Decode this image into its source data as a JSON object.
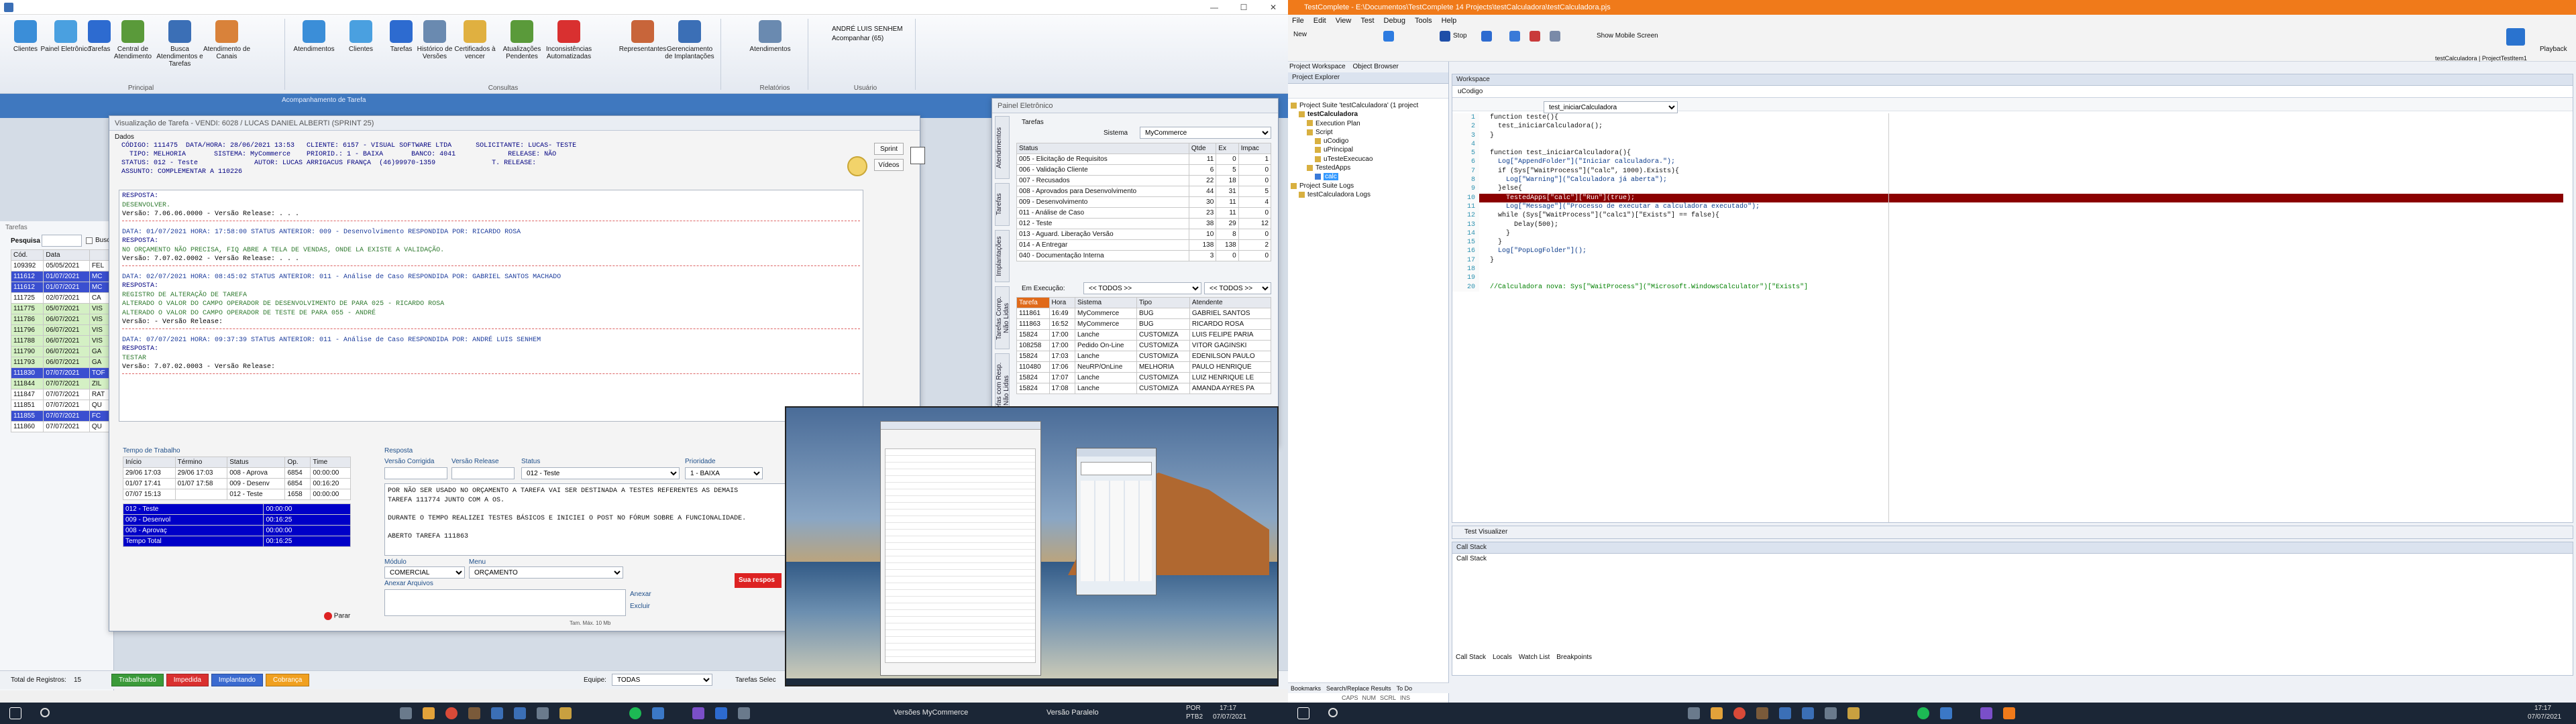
{
  "left": {
    "titlebar": {
      "controls": [
        "—",
        "☐",
        "✕"
      ]
    },
    "ribbon": {
      "buttons": [
        "Clientes",
        "Painel Eletrônico",
        "Tarefas",
        "Central de Atendimento",
        "Busca Atendimentos e Tarefas",
        "Atendimento de Canais",
        "Atendimentos",
        "Clientes",
        "Tarefas",
        "Histórico de Versões",
        "Certificados à vencer",
        "Atualizações Pendentes",
        "Inconsistências Automatizadas",
        "Representantes",
        "Gerenciamento de Implantações",
        "Atendimentos"
      ],
      "groups": [
        "Principal",
        "Consultas",
        "Relatórios",
        "Usuário"
      ],
      "user_name": "ANDRÉ LUIS SENHEM",
      "user_sub": "Acompanhar (65)"
    },
    "main_window_title": "Acompanhamento de Tarefa",
    "background_list": {
      "title": "Tarefas",
      "search_label": "Pesquisa",
      "search_check": "Busc",
      "headers": [
        "Cód.",
        "Data"
      ],
      "rows": [
        [
          "109392",
          "05/05/2021",
          "FEL"
        ],
        [
          "111612",
          "01/07/2021",
          "MC"
        ],
        [
          "111612",
          "01/07/2021",
          "MC"
        ],
        [
          "111725",
          "02/07/2021",
          "CA"
        ],
        [
          "111775",
          "05/07/2021",
          "VIS"
        ],
        [
          "111786",
          "06/07/2021",
          "VIS"
        ],
        [
          "111796",
          "06/07/2021",
          "VIS"
        ],
        [
          "111788",
          "06/07/2021",
          "VIS"
        ],
        [
          "111790",
          "06/07/2021",
          "GA"
        ],
        [
          "111793",
          "06/07/2021",
          "GA"
        ],
        [
          "111830",
          "07/07/2021",
          "TOF"
        ],
        [
          "111844",
          "07/07/2021",
          "ZIL"
        ],
        [
          "111847",
          "07/07/2021",
          "RAT"
        ],
        [
          "111851",
          "07/07/2021",
          "QU"
        ],
        [
          "111855",
          "07/07/2021",
          "FC"
        ],
        [
          "111860",
          "07/07/2021",
          "QU"
        ]
      ],
      "total_label": "Total de Registros:",
      "total_value": "15",
      "legend": [
        "Trabalhando",
        "Impedida",
        "Implantando",
        "Cobrança"
      ],
      "equipe_label": "Equipe:",
      "equipe_value": "TODAS",
      "tarefas_label": "Tarefas Selec"
    },
    "task_dialog": {
      "title": "Visualização de Tarefa - VENDI: 6028 / LUCAS DANIEL ALBERTI (SPRINT 25)",
      "dados_label": "Dados",
      "header_lines": [
        "CÓDIGO: 111475  DATA/HORA: 28/06/2021 13:53   CLIENTE: 6157 - VISUAL SOFTWARE LTDA      SOLICITANTE: LUCAS- TESTE",
        "  TIPO: MELHORIA       SISTEMA: MyCommerce    PRIORID.: 1 - BAIXA       BANCO: 4041             RELEASE: NÃO",
        "STATUS: 012 - Teste              AUTOR: LUCAS ARRIGACUS FRANÇA  (46)99970-1359              T. RELEASE:"
      ],
      "assunto": "ASSUNTO: COMPLEMENTAR A 110226",
      "side_buttons": [
        "Sprint",
        "Vídeos"
      ],
      "history": [
        {
          "line": "RESPOSTA:",
          "color": "navy"
        },
        {
          "line": "DESENVOLVER.",
          "color": "green"
        },
        {
          "line": "Versão: 7.06.06.0000  - Versão Release: . . .",
          "color": "mixed"
        },
        {
          "line": "DATA: 01/07/2021 HORA: 17:58:00   STATUS ANTERIOR: 009 - Desenvolvimento   RESPONDIDA POR: RICARDO ROSA",
          "color": "blue"
        },
        {
          "line": "RESPOSTA:",
          "color": "navy"
        },
        {
          "line": "NO ORÇAMENTO NÃO PRECISA, FIQ ABRE A TELA DE VENDAS, ONDE LA EXISTE A VALIDAÇÃO.",
          "color": "green"
        },
        {
          "line": "Versão: 7.07.02.0002  - Versão Release: . . .",
          "color": "mixed"
        },
        {
          "line": "DATA: 02/07/2021 HORA: 08:45:02   STATUS ANTERIOR: 011 - Análise de Caso  RESPONDIDA POR: GABRIEL SANTOS MACHADO",
          "color": "blue"
        },
        {
          "line": "RESPOSTA:",
          "color": "navy"
        },
        {
          "line": "REGISTRO DE ALTERAÇÃO DE TAREFA",
          "color": "green"
        },
        {
          "line": "ALTERADO O VALOR DO CAMPO OPERADOR DE DESENVOLVIMENTO DE  PARA 025 - RICARDO ROSA",
          "color": "green"
        },
        {
          "line": "ALTERADO O VALOR DO CAMPO OPERADOR DE TESTE DE  PARA 055 - ANDRÉ",
          "color": "green"
        },
        {
          "line": "Versão: -  Versão Release:",
          "color": "mixed"
        },
        {
          "line": "DATA: 07/07/2021 HORA: 09:37:39   STATUS ANTERIOR: 011 - Análise de Caso  RESPONDIDA POR: ANDRÉ LUIS SENHEM",
          "color": "blue"
        },
        {
          "line": "RESPOSTA:",
          "color": "navy"
        },
        {
          "line": "TESTAR",
          "color": "green"
        },
        {
          "line": "Versão: 7.07.02.0003  - Versão Release:",
          "color": "mixed"
        }
      ],
      "tempo": {
        "title": "Tempo de Trabalho",
        "headers": [
          "Início",
          "Término",
          "Status",
          "Op.",
          "Time"
        ],
        "rows": [
          [
            "29/06 17:03",
            "29/06 17:03",
            "008 - Aprova",
            "6854",
            "00:00:00"
          ],
          [
            "01/07 17:41",
            "01/07 17:58",
            "009 - Desenv",
            "6854",
            "00:16:20"
          ],
          [
            "07/07 15:13",
            "",
            "012 - Teste",
            "1658",
            "00:00:00"
          ]
        ],
        "summary": [
          [
            "012 - Teste",
            "00:00:00"
          ],
          [
            "009 - Desenvol",
            "00:16:25"
          ],
          [
            "008 - Aprovaç",
            "00:00:00"
          ],
          [
            "Tempo Total",
            "00:16:25"
          ]
        ],
        "stop_button": "Parar"
      },
      "resposta": {
        "label": "Resposta",
        "versao_corrigida": "Versão Corrigida",
        "versao_release": "Versão Release",
        "status_label": "Status",
        "status_value": "012 - Teste",
        "prioridade_label": "Prioridade",
        "prioridade_value": "1 - BAIXA",
        "text_lines": [
          "POR NÃO SER USADO NO ORÇAMENTO A TAREFA VAI SER DESTINADA A TESTES REFERENTES AS DEMAIS",
          "TAREFA 111774 JUNTO COM A OS.",
          "",
          "DURANTE O TEMPO REALIZEI TESTES BÁSICOS E INICIEI O POST NO FÓRUM SOBRE A FUNCIONALIDADE.",
          "",
          "ABERTO TAREFA 111863"
        ],
        "modulo_label": "Módulo",
        "modulo_value": "COMERCIAL",
        "menu_label": "Menu",
        "menu_value": "ORÇAMENTO",
        "anexar_label": "Anexar Arquivos",
        "anexar_btn": "Anexar",
        "excluir_btn": "Excluir",
        "tam_max": "Tam. Máx. 10 Mb",
        "sua_resposta": "Sua respos"
      }
    },
    "painel": {
      "title": "Painel Eletrônico",
      "tab_tarefas": "Tarefas",
      "sistema_label": "Sistema",
      "sistema_value": "MyCommerce",
      "vtabs": [
        "Atendimentos",
        "Tarefas",
        "Implantações",
        "Tarefas Comp. Não Lidas",
        "Tarefas com Resp. Não Lidas"
      ],
      "status_headers": [
        "Status",
        "Qtde",
        "Ex",
        "Impac"
      ],
      "status_rows": [
        [
          "005 - Elicitação de Requisitos",
          "11",
          "0",
          "1"
        ],
        [
          "006 - Validação Cliente",
          "6",
          "5",
          "0"
        ],
        [
          "007 - Recusados",
          "22",
          "18",
          "0"
        ],
        [
          "008 - Aprovados para Desenvolvimento",
          "44",
          "31",
          "5"
        ],
        [
          "009 - Desenvolvimento",
          "30",
          "11",
          "4"
        ],
        [
          "011 - Análise de Caso",
          "23",
          "11",
          "0"
        ],
        [
          "012 - Teste",
          "38",
          "29",
          "12"
        ],
        [
          "013 - Aguard. Liberação Versão",
          "10",
          "8",
          "0"
        ],
        [
          "014 - A Entregar",
          "138",
          "138",
          "2"
        ],
        [
          "040 - Documentação Interna",
          "3",
          "0",
          "0"
        ]
      ],
      "em_execucao": "Em Execução:",
      "todos1": "<< TODOS >>",
      "todos2": "<< TODOS >>",
      "exec_headers": [
        "Tarefa",
        "Hora",
        "Sistema",
        "Tipo",
        "Atendente"
      ],
      "exec_rows": [
        [
          "111861",
          "16:49",
          "MyCommerce",
          "BUG",
          "GABRIEL SANTOS"
        ],
        [
          "111863",
          "16:52",
          "MyCommerce",
          "BUG",
          "RICARDO ROSA"
        ],
        [
          "15824",
          "17:00",
          "Lanche",
          "CUSTOMIZA",
          "LUIS FELIPE PARIA"
        ],
        [
          "108258",
          "17:00",
          "Pedido On-Line",
          "CUSTOMIZA",
          "VITOR GAGINSKI"
        ],
        [
          "15824",
          "17:03",
          "Lanche",
          "CUSTOMIZA",
          "EDENILSON PAULO"
        ],
        [
          "110480",
          "17:06",
          "NeuRP/OnLine",
          "MELHORIA",
          "PAULO HENRIQUE"
        ],
        [
          "15824",
          "17:07",
          "Lanche",
          "CUSTOMIZA",
          "LUIZ HENRIQUE LE"
        ],
        [
          "15824",
          "17:08",
          "Lanche",
          "CUSTOMIZA",
          "AMANDA AYRES PA"
        ]
      ]
    }
  },
  "right": {
    "title": "TestComplete - E:\\Documentos\\TestComplete 14 Projects\\testCalculadora\\testCalculadora.pjs",
    "menu": [
      "File",
      "Edit",
      "View",
      "Test",
      "Debug",
      "Tools",
      "Help"
    ],
    "toolbar": {
      "new": "New",
      "stop": "Stop",
      "mobile": "Show Mobile Screen"
    },
    "playback": "Playback",
    "playback_sub": "testCalculadora | ProjectTestItem1",
    "tabs_left": [
      "Project Workspace",
      "Object Browser"
    ],
    "explorer_title": "Project Explorer",
    "tree": [
      "Project Suite 'testCalculadora' (1 project",
      "testCalculadora",
      "Execution Plan",
      "Script",
      "uCodigo",
      "uPrincipal",
      "uTesteExecucao",
      "TestedApps",
      "calc",
      "Project Suite Logs",
      "testCalculadora Logs"
    ],
    "workspace_title": "Workspace",
    "file_tab": "uCodigo",
    "func_select": "test_iniciarCalculadora",
    "code_lines": [
      "function teste(){",
      "  test_iniciarCalculadora();",
      "}",
      "",
      "function test_iniciarCalculadora(){",
      "  Log[\"AppendFolder\"](\"Iniciar calculadora.\");",
      "  if (Sys[\"WaitProcess\"](\"calc\", 1000).Exists){",
      "    Log[\"Warning\"](\"Calculadora já aberta\");",
      "  }else{",
      "    TestedApps[\"calc\"][\"Run\"](true);",
      "    Log[\"Message\"](\"Processo de executar a calculadora executado\");",
      "  while (Sys[\"WaitProcess\"](\"calc1\")[\"Exists\"] == false){",
      "      Delay(500);",
      "    }",
      "  }",
      "  Log[\"PopLogFolder\"]();",
      "}",
      "",
      "",
      "//Calculadora nova: Sys[\"WaitProcess\"](\"Microsoft.WindowsCalculator\")[\"Exists\"]"
    ],
    "line_numbers": [
      "1",
      "2",
      "3",
      "4",
      "5",
      "6",
      "7",
      "8",
      "9",
      "10",
      "11",
      "12",
      "13",
      "14",
      "15",
      "16",
      "17",
      "18",
      "19",
      "20"
    ],
    "test_visualizer": "Test Visualizer",
    "call_stack_title": "Call Stack",
    "call_stack_content": "Call Stack",
    "bottom_tabs": [
      "Call Stack",
      "Locals",
      "Watch List",
      "Breakpoints"
    ],
    "left_bottom_tabs": [
      "Bookmarks",
      "Search/Replace Results",
      "To Do"
    ],
    "status_right": [
      "CAPS",
      "NUM",
      "SCRL",
      "INS"
    ]
  },
  "taskbar": {
    "left_items": [
      "Versões MyCommerce",
      "Versão Paralelo"
    ],
    "lang": "POR",
    "lang2": "PTB2",
    "time": "17:17",
    "date": "07/07/2021",
    "right_time": "17:17",
    "right_date": "07/07/2021"
  },
  "colors": {
    "testcomplete_orange": "#f07a1a",
    "breakpoint_red": "#8b0000",
    "selected_row_blue": "#0000c8"
  }
}
